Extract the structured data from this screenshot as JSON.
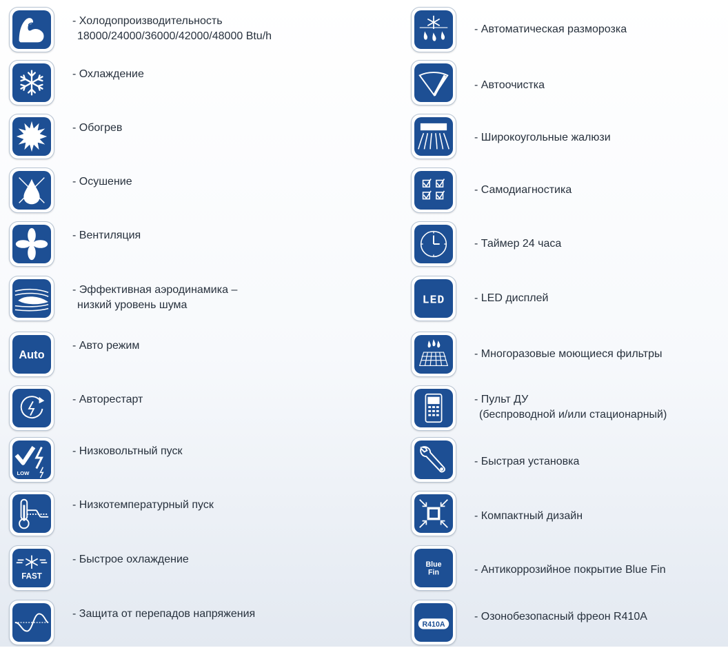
{
  "left_column": [
    {
      "icon": "muscle-arm-icon",
      "line1": "- Холодопроизводительность",
      "line2": "18000/24000/36000/42000/48000 Btu/h"
    },
    {
      "icon": "snowflake-icon",
      "line1": "- Охлаждение",
      "line2": ""
    },
    {
      "icon": "sun-icon",
      "line1": "- Обогрев",
      "line2": ""
    },
    {
      "icon": "water-drop-icon",
      "line1": "- Осушение",
      "line2": ""
    },
    {
      "icon": "fan-icon",
      "line1": "- Вентиляция",
      "line2": ""
    },
    {
      "icon": "airflow-icon",
      "line1": "- Эффективная аэродинамика –",
      "line2": "низкий уровень шума"
    },
    {
      "icon": "auto-icon",
      "icon_text": "Auto",
      "line1": "- Авто режим",
      "line2": ""
    },
    {
      "icon": "restart-icon",
      "line1": "- Авторестарт",
      "line2": ""
    },
    {
      "icon": "low-voltage-icon",
      "icon_text": "LOW",
      "line1": "- Низковольтный пуск",
      "line2": ""
    },
    {
      "icon": "thermometer-icon",
      "line1": " - Низкотемпературный пуск",
      "line2": ""
    },
    {
      "icon": "fast-cooling-icon",
      "icon_text": "FAST",
      "line1": "- Быстрое охлаждение",
      "line2": ""
    },
    {
      "icon": "sine-wave-icon",
      "line1": "- Защита от перепадов напряжения",
      "line2": ""
    }
  ],
  "right_column": [
    {
      "icon": "defrost-icon",
      "line1": "- Автоматическая разморозка",
      "line2": ""
    },
    {
      "icon": "wiper-icon",
      "line1": "- Автоочистка",
      "line2": ""
    },
    {
      "icon": "louver-icon",
      "line1": "- Широкоугольные жалюзи",
      "line2": ""
    },
    {
      "icon": "checklist-icon",
      "line1": "- Самодиагностика",
      "line2": ""
    },
    {
      "icon": "clock-icon",
      "line1": "- Таймер 24 часа",
      "line2": ""
    },
    {
      "icon": "led-display-icon",
      "icon_text": "LED",
      "line1": "- LED дисплей",
      "line2": ""
    },
    {
      "icon": "filter-icon",
      "line1": "- Многоразовые моющиеся фильтры",
      "line2": ""
    },
    {
      "icon": "remote-control-icon",
      "line1": "- Пульт ДУ",
      "line2": "(беспроводной и/или стационарный)"
    },
    {
      "icon": "wrench-icon",
      "line1": "- Быстрая установка",
      "line2": ""
    },
    {
      "icon": "compact-design-icon",
      "line1": "- Компактный дизайн",
      "line2": ""
    },
    {
      "icon": "blue-fin-icon",
      "icon_text": "Blue Fin",
      "line1": "- Антикоррозийное покрытие Blue Fin",
      "line2": ""
    },
    {
      "icon": "r410a-icon",
      "icon_text": "R410A",
      "line1": "- Озонобезопасный фреон R410A",
      "line2": ""
    }
  ],
  "colors": {
    "icon_fill": "#1d4f94",
    "icon_border": "#b7c4d3",
    "text": "#27313d"
  }
}
